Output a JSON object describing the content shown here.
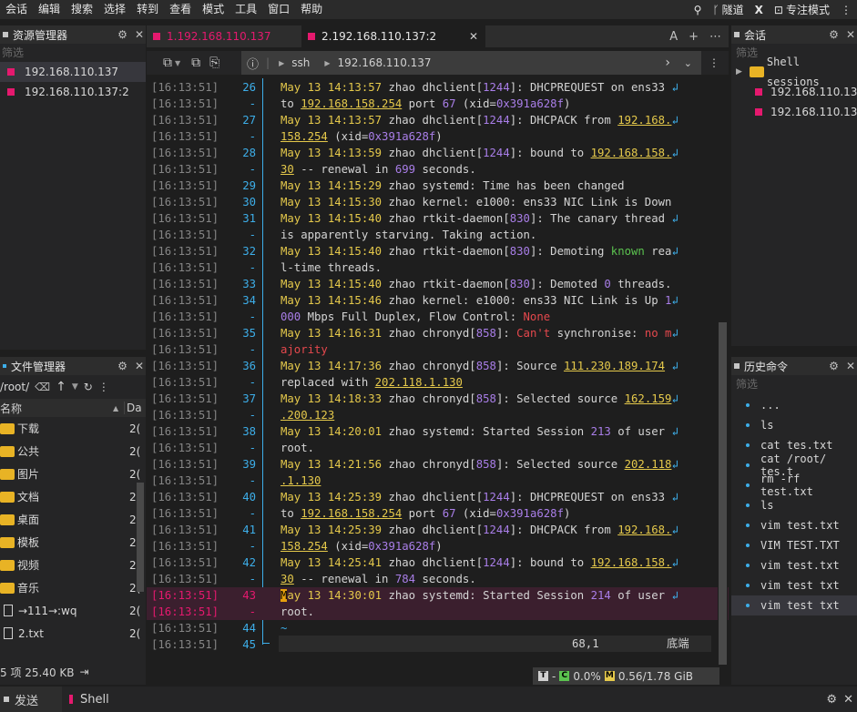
{
  "menubar": {
    "items": [
      "会话",
      "编辑",
      "搜索",
      "选择",
      "转到",
      "查看",
      "模式",
      "工具",
      "窗口",
      "帮助"
    ],
    "tunnel": "隧道",
    "focus": "专注模式"
  },
  "session_panel": {
    "title": "资源管理器",
    "filter": "筛选",
    "items": [
      "192.168.110.137",
      "192.168.110.137:2"
    ]
  },
  "file_manager": {
    "title": "文件管理器",
    "path": "/root/",
    "col_name": "名称",
    "col_date": "Da",
    "rows": [
      {
        "name": "下载",
        "type": "folder",
        "date": "2("
      },
      {
        "name": "公共",
        "type": "folder",
        "date": "2("
      },
      {
        "name": "图片",
        "type": "folder",
        "date": "2("
      },
      {
        "name": "文档",
        "type": "folder",
        "date": "2("
      },
      {
        "name": "桌面",
        "type": "folder",
        "date": "2("
      },
      {
        "name": "模板",
        "type": "folder",
        "date": "2("
      },
      {
        "name": "视频",
        "type": "folder",
        "date": "2("
      },
      {
        "name": "音乐",
        "type": "folder",
        "date": "2("
      },
      {
        "name": "→111→:wq",
        "type": "file",
        "date": "2("
      },
      {
        "name": "2.txt",
        "type": "file",
        "date": "2("
      }
    ],
    "status": "5 项 25.40 KB"
  },
  "tabs": [
    {
      "label": "1.192.168.110.137",
      "active": false
    },
    {
      "label": "2.192.168.110.137:2",
      "active": true
    }
  ],
  "tab_right": {
    "font_btn": "A",
    "add": "+",
    "more": "⋯"
  },
  "address": {
    "proto": "ssh",
    "host": "192.168.110.137"
  },
  "terminal": {
    "timestamp": "[16:13:51]",
    "status_pos": "68,1",
    "status_where": "底端",
    "tilde": "~"
  },
  "term_stats": {
    "cpu": "0.0%",
    "mem": "0.56/1.78 GiB",
    "t_label": "T",
    "c_label": "C",
    "m_label": "M",
    "dash": "-"
  },
  "right_top": {
    "title": "会话",
    "filter": "筛选",
    "folder": "Shell sessions",
    "items": [
      "192.168.110.13",
      "192.168.110.13"
    ]
  },
  "history": {
    "title": "历史命令",
    "filter": "筛选",
    "items": [
      "...",
      "ls",
      "cat tes.txt",
      "cat /root/ tes.t",
      "rm -rf test.txt",
      "ls",
      "vim test.txt",
      "VIM TEST.TXT",
      "vim test.txt",
      "vim test txt",
      "vim test txt"
    ]
  },
  "bottombar": {
    "send": "发送",
    "shell": "Shell"
  },
  "colors": {
    "accent": "#3daee9",
    "pink": "#e5196e",
    "yellow": "#e5c94b",
    "purple": "#a97ee8",
    "green": "#5bc24f",
    "red": "#e5484d"
  }
}
